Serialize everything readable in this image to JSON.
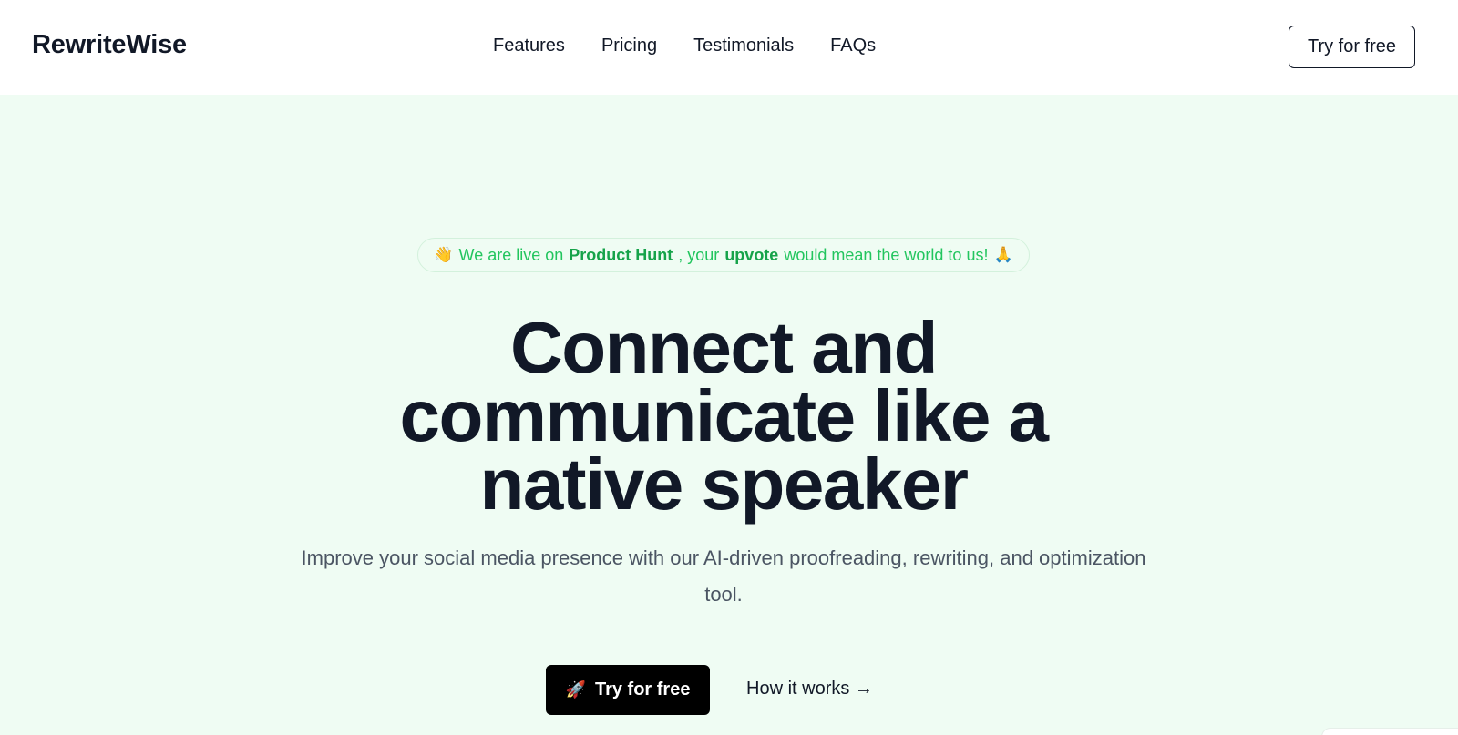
{
  "header": {
    "logo": "RewriteWise",
    "nav": [
      "Features",
      "Pricing",
      "Testimonials",
      "FAQs"
    ],
    "cta": "Try for free"
  },
  "hero": {
    "announcement": {
      "wave_icon": "👋",
      "text1": "We are live on",
      "bold1": "Product Hunt",
      "text2": ", your",
      "bold2": "upvote",
      "text3": "would mean the world to us!",
      "pray_icon": "🙏"
    },
    "headline": "Connect and communicate like a native speaker",
    "subtext": "Improve your social media presence with our AI-driven proofreading, rewriting, and optimization tool.",
    "cta_primary_icon": "🚀",
    "cta_primary": "Try for free",
    "cta_secondary": "How it works →"
  },
  "colors": {
    "hero_bg": "#effcf3",
    "accent_green": "#22c55e",
    "text_dark": "#111827",
    "button_black": "#000000"
  }
}
